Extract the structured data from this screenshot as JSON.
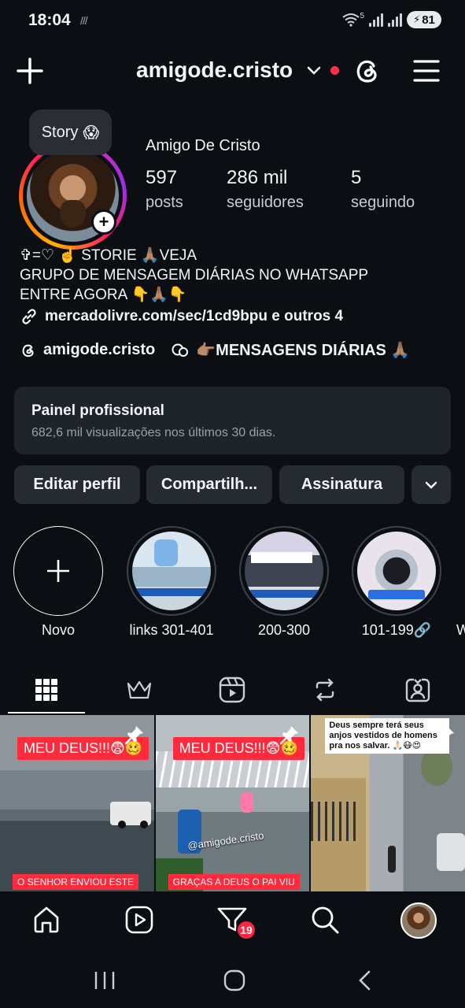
{
  "status": {
    "time": "18:04",
    "extra": "///",
    "wifi_mark": "5",
    "battery": "81"
  },
  "header": {
    "username": "amigode.cristo"
  },
  "story_tip": {
    "text": "Story",
    "emoji": "😱"
  },
  "profile": {
    "display_name": "Amigo De Cristo",
    "stats": [
      {
        "value": "597",
        "label": "posts"
      },
      {
        "value": "286 mil",
        "label": "seguidores"
      },
      {
        "value": "5",
        "label": "seguindo"
      }
    ],
    "bio_lines": [
      "✞=♡ ☝️ STORIE 🙏🏽VEJA",
      "GRUPO DE MENSAGEM DIÁRIAS NO WHATSAPP",
      "ENTRE AGORA 👇🙏🏽👇"
    ],
    "link": "mercadolivre.com/sec/1cd9bpu e outros 4",
    "threads_handle": "amigode.cristo",
    "channel": "👉🏽MENSAGENS DIÁRIAS 🙏🏽"
  },
  "dashboard": {
    "title": "Painel profissional",
    "subtitle": "682,6 mil visualizações nos últimos 30 dias."
  },
  "buttons": {
    "edit": "Editar perfil",
    "share": "Compartilh...",
    "subscription": "Assinatura"
  },
  "highlights": [
    {
      "label": "Novo"
    },
    {
      "label": "links 301-401"
    },
    {
      "label": "200-300"
    },
    {
      "label": "101-199🔗"
    },
    {
      "label": "W"
    }
  ],
  "posts": [
    {
      "tag": "MEU DEUS!!!😨🥴",
      "caption": "O SENHOR ENVIOU ESTE"
    },
    {
      "tag": "MEU DEUS!!!😨🥴",
      "caption": "GRAÇAS A DEUS O PAI VIU",
      "watermark": "@amigode.cristo"
    },
    {
      "quote": "Deus sempre terá seus anjos vestidos de homens pra nos salvar. 🙏🏻😷😍"
    }
  ],
  "nav": {
    "badge": "19"
  },
  "colors": {
    "background": "#0b0f14",
    "surface": "#262b32",
    "accent_red": "#ff2a3b"
  }
}
